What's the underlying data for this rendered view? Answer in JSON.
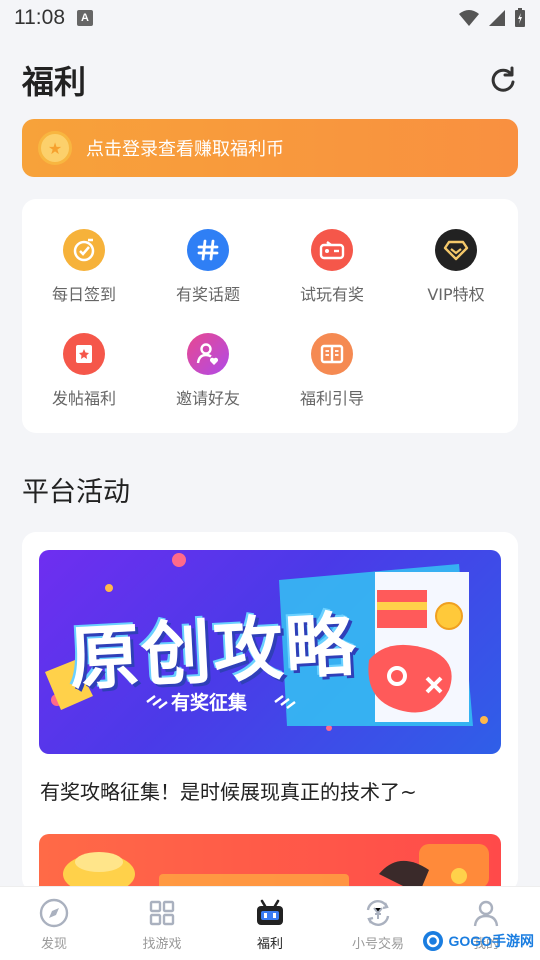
{
  "status_bar": {
    "time": "11:08",
    "notification_letter": "A"
  },
  "header": {
    "title": "福利"
  },
  "login_banner": {
    "text": "点击登录查看赚取福利币"
  },
  "grid": [
    {
      "label": "每日签到",
      "icon": "checkin-icon",
      "color": "#f6b23a"
    },
    {
      "label": "有奖话题",
      "icon": "hash-icon",
      "color": "#2f7ff5"
    },
    {
      "label": "试玩有奖",
      "icon": "gamepad-icon",
      "color": "#f5574a"
    },
    {
      "label": "VIP特权",
      "icon": "vip-diamond-icon",
      "color": "#222222"
    },
    {
      "label": "发帖福利",
      "icon": "post-icon",
      "color": "#f5574a"
    },
    {
      "label": "邀请好友",
      "icon": "invite-friend-icon",
      "color": "#e8488f"
    },
    {
      "label": "福利引导",
      "icon": "guide-book-icon",
      "color": "#f58a52"
    }
  ],
  "section": {
    "title": "平台活动"
  },
  "activity": {
    "poster_title": "原创攻略",
    "poster_subtitle": "有奖征集",
    "caption": "有奖攻略征集！是时候展现真正的技术了~"
  },
  "tabs": [
    {
      "label": "发现",
      "icon": "compass-icon",
      "active": false
    },
    {
      "label": "找游戏",
      "icon": "grid-icon",
      "active": false
    },
    {
      "label": "福利",
      "icon": "robot-icon",
      "active": true
    },
    {
      "label": "小号交易",
      "icon": "exchange-icon",
      "active": false
    },
    {
      "label": "我的",
      "icon": "person-icon",
      "active": false
    }
  ],
  "watermark": {
    "text": "GOGO手游网"
  },
  "colors": {
    "accent_orange": "#f99040",
    "primary_text": "#222222",
    "secondary_text": "#666666"
  }
}
